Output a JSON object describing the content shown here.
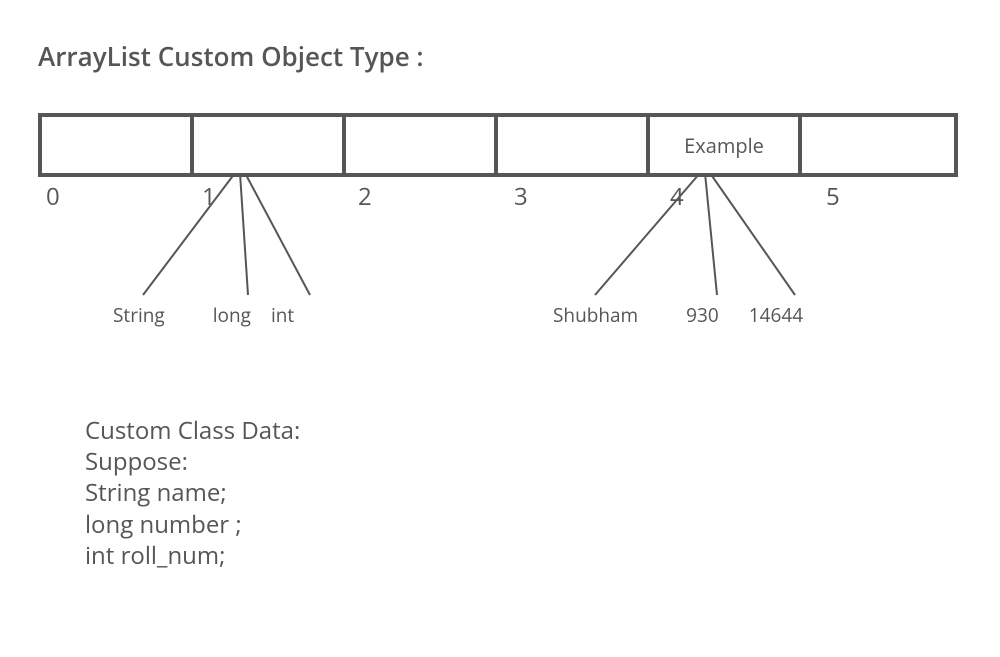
{
  "title": "ArrayList Custom Object Type :",
  "array": {
    "cells": [
      "",
      "",
      "",
      "",
      "Example",
      ""
    ],
    "indices": [
      "0",
      "1",
      "2",
      "3",
      "4",
      "5"
    ]
  },
  "fork1": {
    "labels": [
      "String",
      "long",
      "int"
    ]
  },
  "fork2": {
    "labels": [
      "Shubham",
      "930",
      "14644"
    ]
  },
  "bottomText": {
    "line1": "Custom Class Data:",
    "line2": "Suppose:",
    "line3": "String name;",
    "line4": "long number ;",
    "line5": "int roll_num;"
  }
}
